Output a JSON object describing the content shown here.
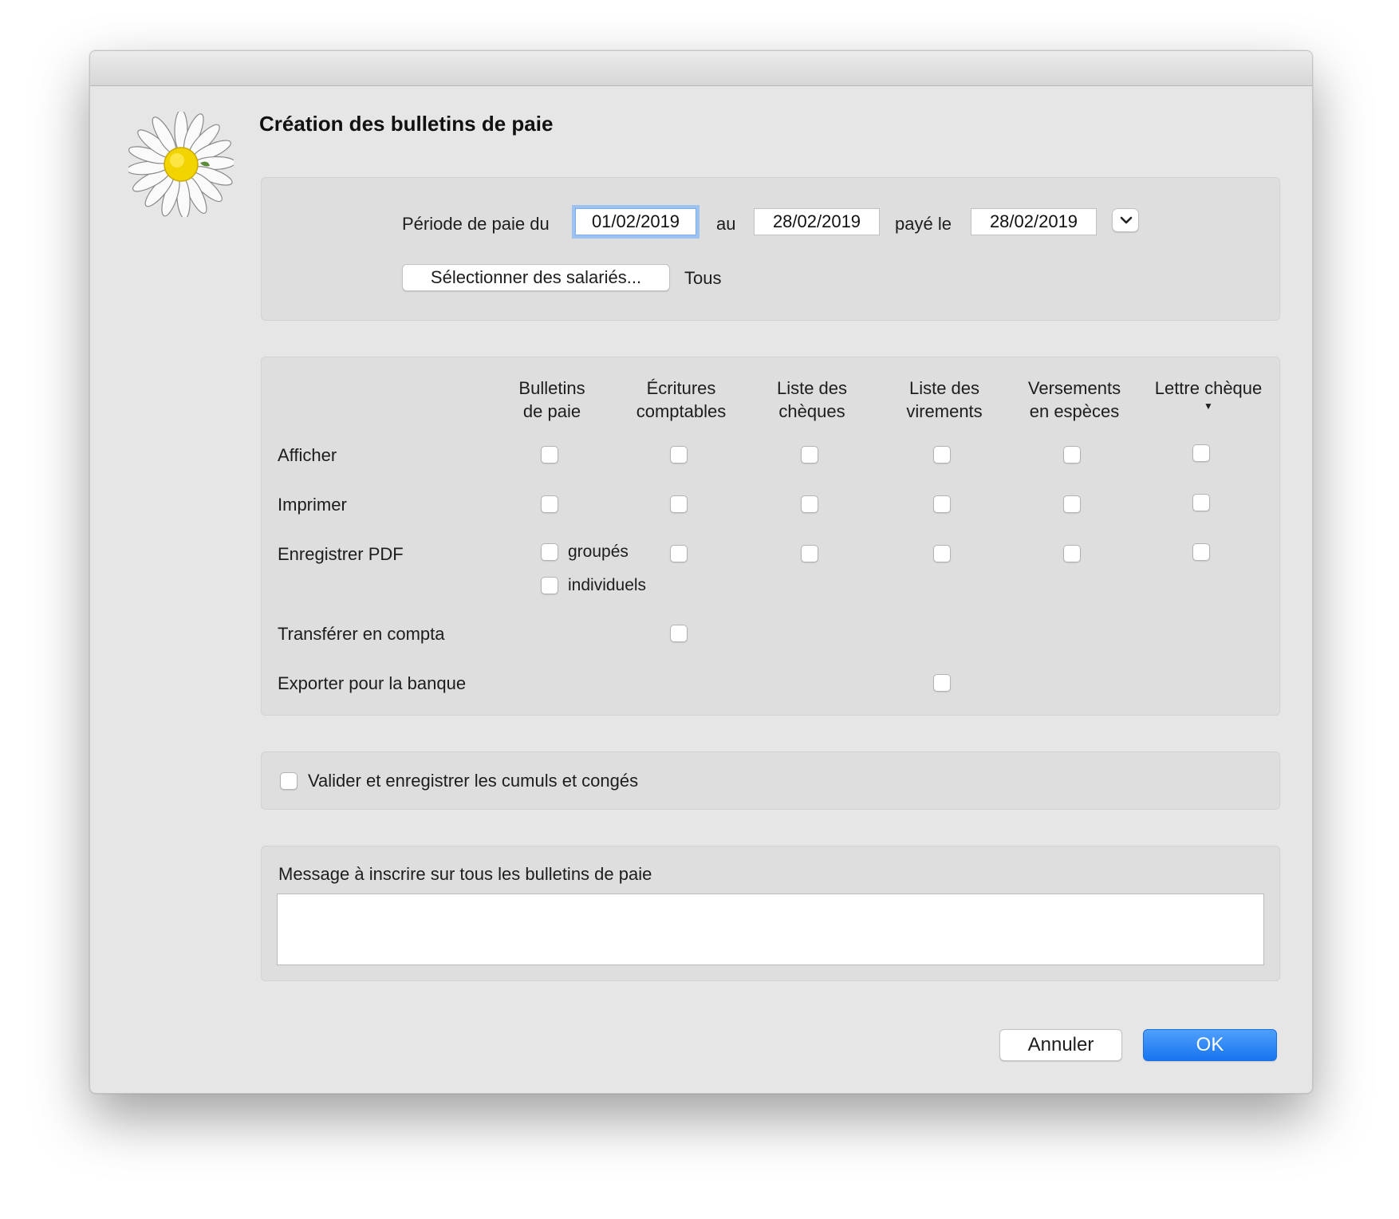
{
  "dialog": {
    "title": "Création des bulletins de paie"
  },
  "period": {
    "label_from": "Période de paie du",
    "from_date": "01/02/2019",
    "label_to": "au",
    "to_date": "28/02/2019",
    "label_paid": "payé le",
    "paid_date": "28/02/2019",
    "select_button": "Sélectionner des salariés...",
    "selection_status": "Tous"
  },
  "outputs": {
    "columns": [
      {
        "line1": "Bulletins",
        "line2": "de paie"
      },
      {
        "line1": "Écritures",
        "line2": "comptables"
      },
      {
        "line1": "Liste des",
        "line2": "chèques"
      },
      {
        "line1": "Liste des",
        "line2": "virements"
      },
      {
        "line1": "Versements",
        "line2": "en espèces"
      },
      {
        "line1": "Lettre chèque",
        "line2": ""
      }
    ],
    "rows": [
      {
        "label": "Afficher"
      },
      {
        "label": "Imprimer"
      },
      {
        "label": "Enregistrer PDF"
      },
      {
        "label": "Transférer en compta"
      },
      {
        "label": "Exporter pour la banque"
      }
    ],
    "pdf_grouped": "groupés",
    "pdf_individual": "individuels"
  },
  "validate": {
    "label": "Valider et enregistrer les cumuls et congés"
  },
  "message": {
    "label": "Message à inscrire sur tous les bulletins de paie",
    "value": ""
  },
  "buttons": {
    "cancel": "Annuler",
    "ok": "OK"
  },
  "colors": {
    "accent": "#1874f0",
    "focus_ring": "#9ec2f0",
    "window_bg": "#e6e6e6",
    "panel_bg": "#dedede"
  }
}
